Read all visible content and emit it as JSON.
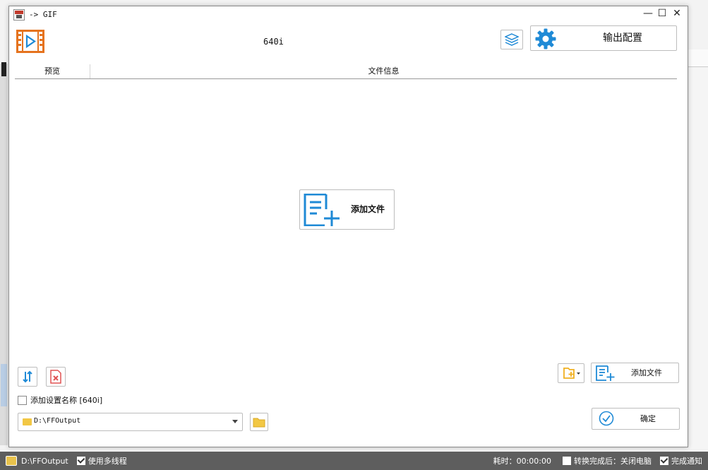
{
  "window": {
    "title": "-> GIF",
    "preset_name": "640i",
    "controls": [
      "—",
      "☐",
      "✕"
    ]
  },
  "header": {
    "output_config_label": "输出配置"
  },
  "file_table": {
    "columns": [
      "预览",
      "文件信息"
    ]
  },
  "center": {
    "add_file_label": "添加文件"
  },
  "bottom": {
    "add_setting_name_label": "添加设置名称 [640i]",
    "add_setting_name_checked": false,
    "output_path": "D:\\FFOutput",
    "add_file_label": "添加文件",
    "ok_label": "确定"
  },
  "statusbar": {
    "path": "D:\\FFOutput",
    "multithread_label": "使用多线程",
    "multithread_checked": true,
    "elapsed": "耗时：00:00:00",
    "after_convert_label": "转换完成后：关闭电脑",
    "after_convert_checked": false,
    "notify_label": "完成通知",
    "notify_checked": true
  },
  "colors": {
    "accent_blue": "#1f8ad6",
    "logo_orange": "#e5731e",
    "folder_yellow": "#f2c744",
    "delete_red": "#e05252",
    "statusbar_bg": "#5e5e5e"
  },
  "icons": {
    "logo": "video-play-icon",
    "layers": "layers-icon",
    "gear": "gear-icon",
    "add_file": "add-file-icon",
    "sort": "sort-icon",
    "delete": "delete-file-icon",
    "folder": "folder-icon",
    "add_folder": "add-folder-icon",
    "ok": "check-circle-icon"
  }
}
